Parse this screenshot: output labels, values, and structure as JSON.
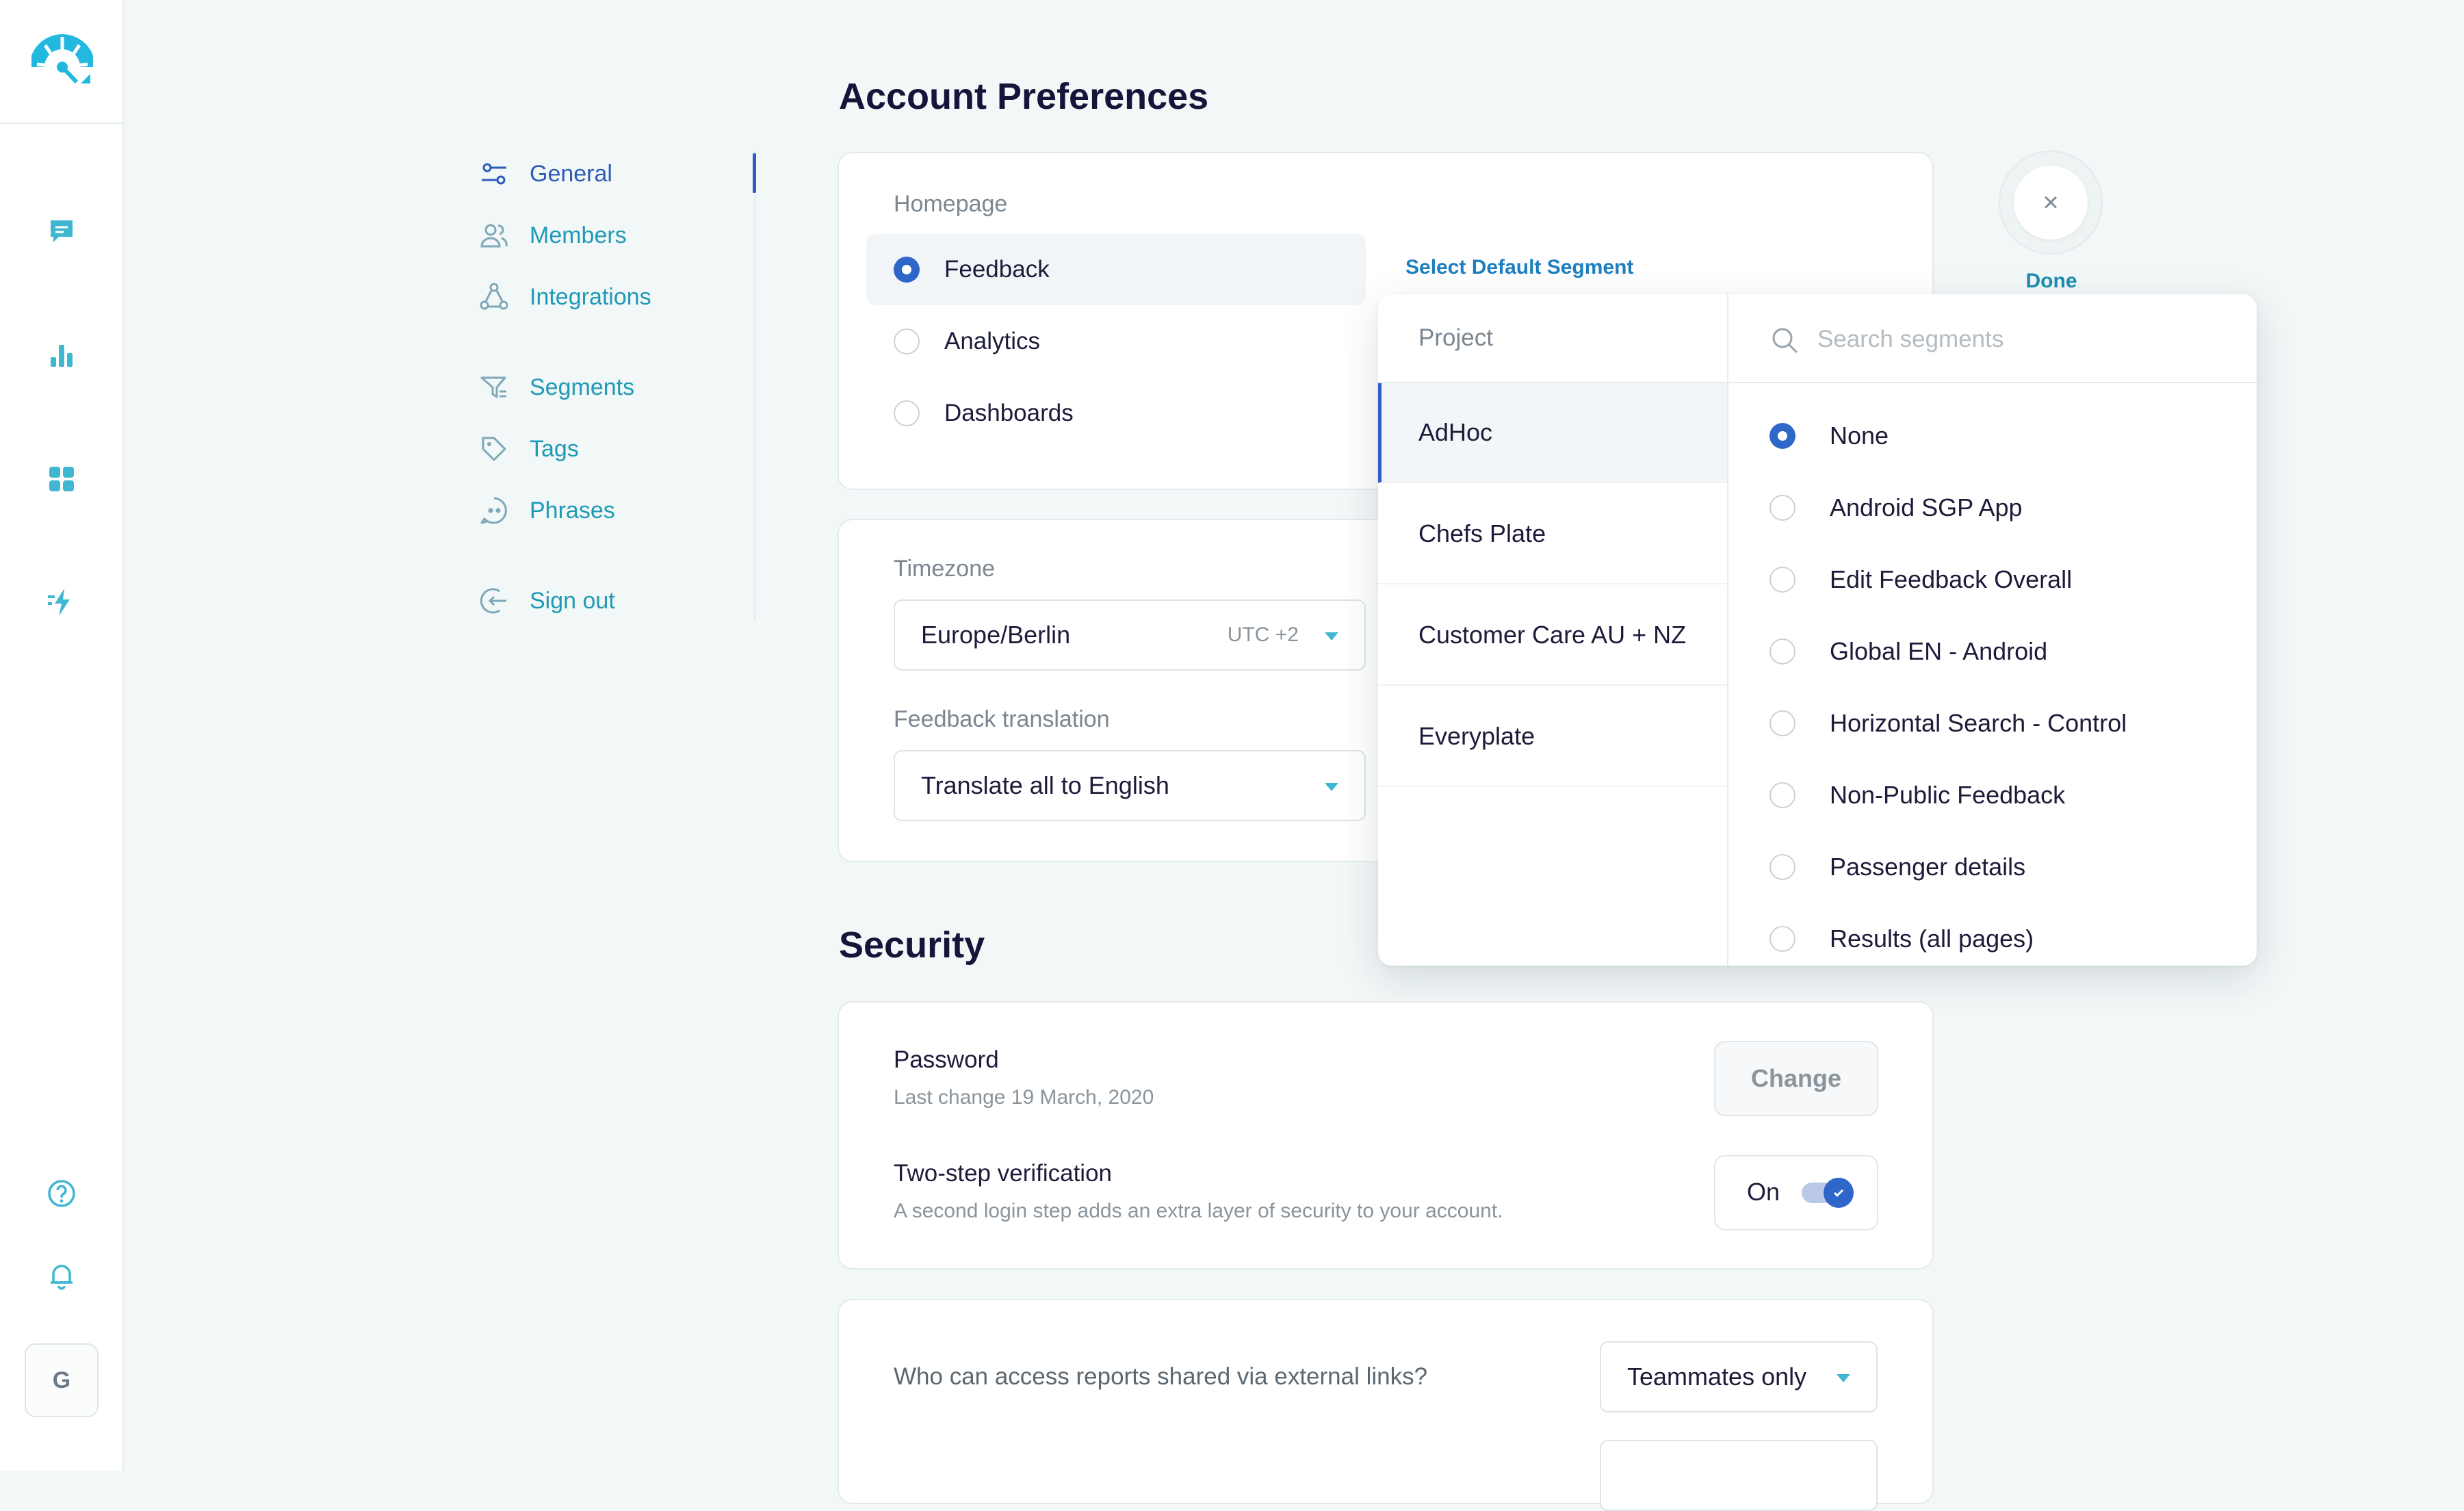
{
  "settings_nav": {
    "items": [
      {
        "label": "General",
        "icon": "sliders-icon",
        "active": true
      },
      {
        "label": "Members",
        "icon": "users-icon"
      },
      {
        "label": "Integrations",
        "icon": "integrations-icon"
      },
      {
        "label": "Segments",
        "icon": "filter-icon"
      },
      {
        "label": "Tags",
        "icon": "tag-icon"
      },
      {
        "label": "Phrases",
        "icon": "quote-icon"
      },
      {
        "label": "Sign out",
        "icon": "sign-out-icon"
      }
    ]
  },
  "rail": {
    "icons": [
      "logo-icon",
      "feedback-chat-icon",
      "bar-chart-icon",
      "dashboard-grid-icon",
      "automation-bolt-icon",
      "help-icon",
      "bell-icon"
    ],
    "avatar_initial": "G"
  },
  "account": {
    "title": "Account Preferences",
    "homepage_label": "Homepage",
    "homepage_options": [
      {
        "label": "Feedback",
        "checked": true
      },
      {
        "label": "Analytics",
        "checked": false
      },
      {
        "label": "Dashboards",
        "checked": false
      }
    ],
    "select_default_segment": "Select Default Segment",
    "timezone_label": "Timezone",
    "timezone_value": "Europe/Berlin",
    "timezone_offset": "UTC +2",
    "translation_label": "Feedback translation",
    "translation_value": "Translate all to English"
  },
  "done": {
    "icon": "close-icon",
    "symbol": "×",
    "label": "Done"
  },
  "segment_picker": {
    "project_header": "Project",
    "search_placeholder": "Search segments",
    "projects": [
      {
        "label": "AdHoc",
        "active": true
      },
      {
        "label": "Chefs Plate"
      },
      {
        "label": "Customer Care AU + NZ"
      },
      {
        "label": "Everyplate"
      }
    ],
    "segments": [
      {
        "label": "None",
        "checked": true
      },
      {
        "label": "Android SGP App"
      },
      {
        "label": "Edit Feedback Overall"
      },
      {
        "label": "Global EN - Android"
      },
      {
        "label": "Horizontal Search - Control"
      },
      {
        "label": "Non-Public Feedback"
      },
      {
        "label": "Passenger details"
      },
      {
        "label": "Results (all pages)"
      }
    ]
  },
  "security": {
    "title": "Security",
    "password_title": "Password",
    "password_sub": "Last change 19 March, 2020",
    "change_button": "Change",
    "twostep_title": "Two-step verification",
    "twostep_sub": "A second login step adds an extra layer of security to your account.",
    "twostep_state": "On",
    "external_question": "Who can access reports shared via external links?",
    "external_value": "Teammates only"
  },
  "colors": {
    "accent": "#2f66c9",
    "teal": "#1f9ab6",
    "background": "#f2f7f7"
  }
}
